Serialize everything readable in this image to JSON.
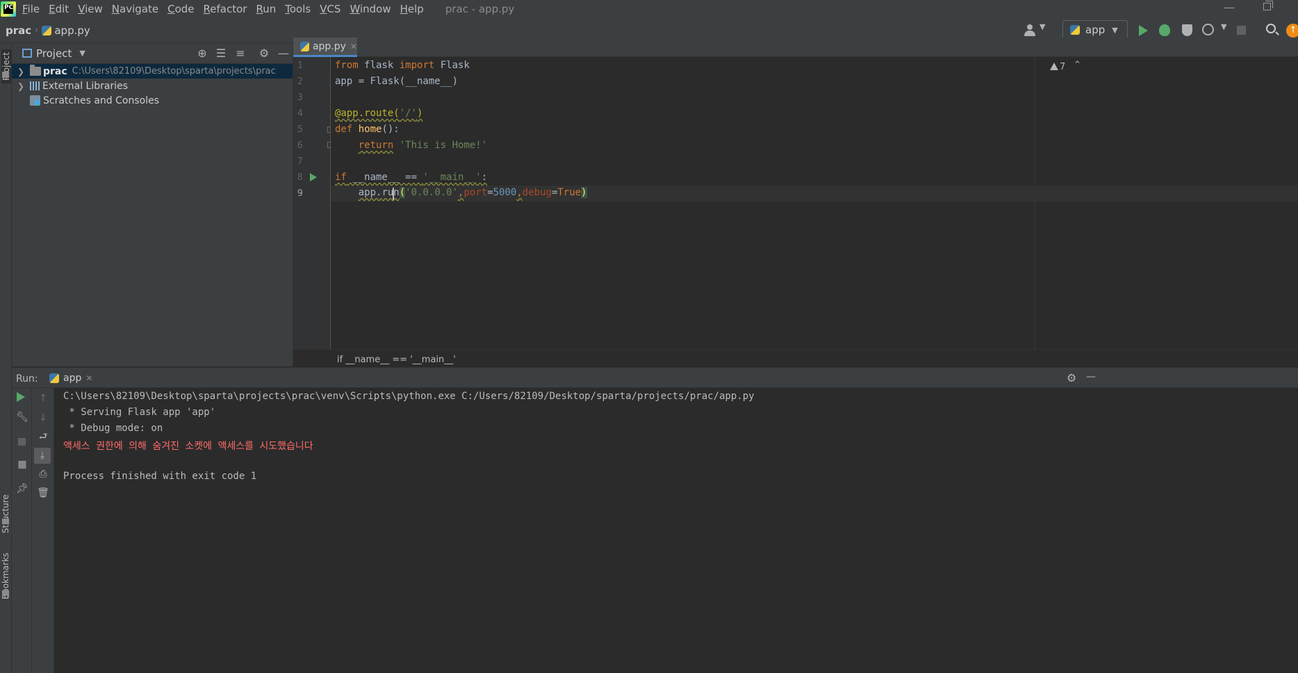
{
  "menubar": {
    "items": [
      "File",
      "Edit",
      "View",
      "Navigate",
      "Code",
      "Refactor",
      "Run",
      "Tools",
      "VCS",
      "Window",
      "Help"
    ],
    "window_title": "prac - app.py",
    "logo_text": "PC"
  },
  "navbar": {
    "breadcrumb_root": "prac",
    "breadcrumb_file": "app.py",
    "run_config": "app"
  },
  "side_tabs": {
    "project": "Project",
    "structure": "Structure",
    "bookmarks": "Bookmarks"
  },
  "project_panel": {
    "title": "Project",
    "tree": [
      {
        "label": "prac",
        "path": "C:\\Users\\82109\\Desktop\\sparta\\projects\\prac"
      },
      {
        "label": "External Libraries"
      },
      {
        "label": "Scratches and Consoles"
      }
    ]
  },
  "editor": {
    "tab_label": "app.py",
    "line_numbers": [
      "1",
      "2",
      "3",
      "4",
      "5",
      "6",
      "7",
      "8",
      "9"
    ],
    "code": {
      "l1_from": "from",
      "l1_mod": " flask ",
      "l1_import": "import",
      "l1_name": " Flask",
      "l2": "app = Flask(__name__)",
      "l4_deco": "@app.route(",
      "l4_str": "'/'",
      "l4_end": ")",
      "l5_def": "def",
      "l5_fn": " home",
      "l5_end": "():",
      "l6_indent": "    ",
      "l6_return": "return",
      "l6_str": " 'This is Home!'",
      "l8_if": "if",
      "l8_name": " __name__ == ",
      "l8_str": "'__main__'",
      "l8_end": ":",
      "l9_indent": "    ",
      "l9_app": "app.",
      "l9_run": "run",
      "l9_open": "(",
      "l9_host": "'0.0.0.0'",
      "l9_comma1": ",",
      "l9_port_kw": "port",
      "l9_eq1": "=",
      "l9_port": "5000",
      "l9_comma2": ",",
      "l9_debug_kw": "debug",
      "l9_eq2": "=",
      "l9_debug": "True",
      "l9_close": ")"
    },
    "warning_count": "7",
    "breadcrumb": "if __name__ == '__main__'"
  },
  "run_panel": {
    "title": "Run:",
    "tab_label": "app",
    "console": [
      "C:\\Users\\82109\\Desktop\\sparta\\projects\\prac\\venv\\Scripts\\python.exe C:/Users/82109/Desktop/sparta/projects/prac/app.py",
      " * Serving Flask app 'app'",
      " * Debug mode: on",
      "액세스 권한에 의해 숨겨진 소켓에 액세스를 시도했습니다",
      "",
      "Process finished with exit code 1"
    ]
  },
  "icons": {
    "run": "run-icon",
    "debug": "debug-icon",
    "search": "search-icon",
    "gear": "gear-icon"
  },
  "colors": {
    "background": "#2b2b2b",
    "panel": "#3c3f41",
    "keyword": "#cc7832",
    "string": "#6a8759",
    "number": "#6897bb",
    "error": "#ff6b68",
    "run_green": "#59a869",
    "selection": "#0d293e"
  }
}
